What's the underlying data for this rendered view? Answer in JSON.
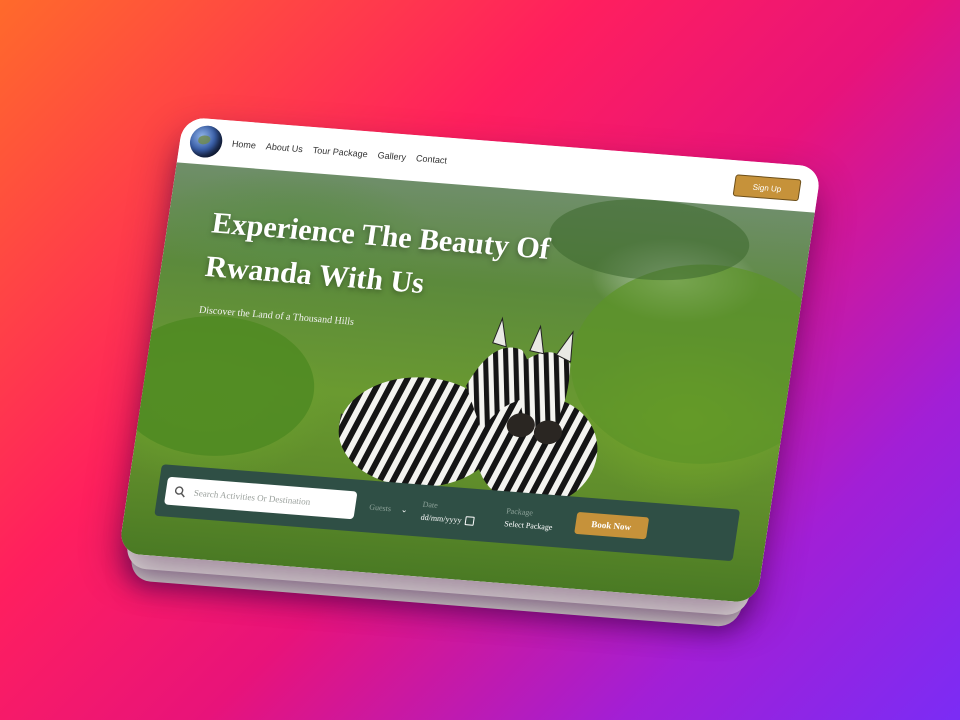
{
  "nav": {
    "links": [
      "Home",
      "About Us",
      "Tour Package",
      "Gallery",
      "Contact"
    ],
    "signup_label": "Sign Up"
  },
  "hero": {
    "title": "Experience The Beauty Of Rwanda With Us",
    "subtitle": "Discover the Land of a Thousand Hills"
  },
  "booking": {
    "search_placeholder": "Search Activities Or Destination",
    "guests_label": "Guests",
    "date_label": "Date",
    "date_value": "dd/mm/yyyy",
    "package_label": "Package",
    "package_value": "Select Package",
    "book_label": "Book Now"
  },
  "colors": {
    "accent": "#c6923a",
    "booking_bar": "#2f4f45"
  },
  "icons": {
    "logo": "globe-icon",
    "search": "search-icon",
    "guests_dropdown": "chevron-down-icon",
    "date": "calendar-icon"
  }
}
